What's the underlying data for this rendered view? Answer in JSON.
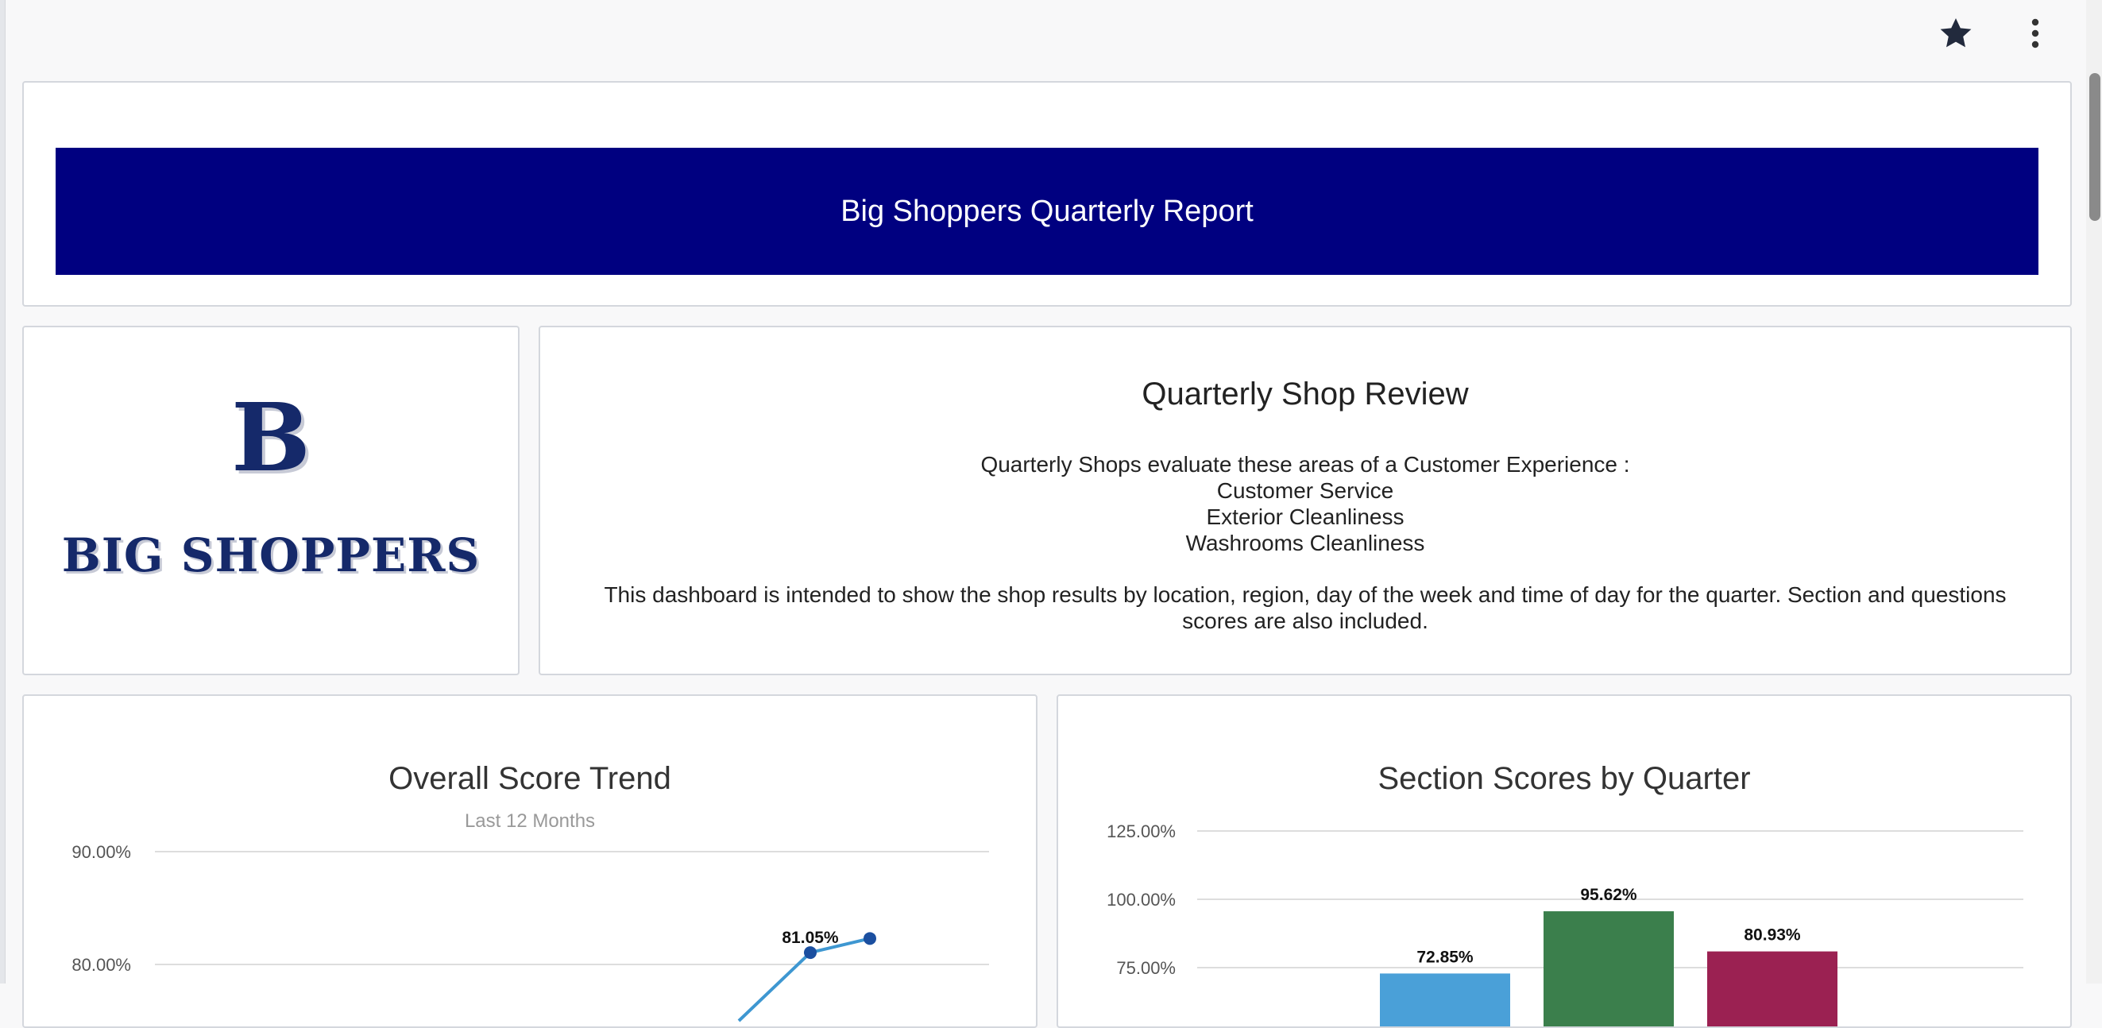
{
  "toolbar": {
    "favorite_icon": "star-icon",
    "more_icon": "more-vertical-icon"
  },
  "header": {
    "title": "Big Shoppers Quarterly Report",
    "banner_color": "#000080"
  },
  "logo": {
    "monogram": "B",
    "brand_text": "BIG SHOPPERS",
    "color": "#15296a"
  },
  "review": {
    "title": "Quarterly Shop Review",
    "intro": "Quarterly Shops evaluate these areas of a Customer Experience :",
    "areas": [
      "Customer Service",
      "Exterior Cleanliness",
      "Washrooms Cleanliness"
    ],
    "description": "This dashboard is intended to show the shop results by location, region, day of the week and time of day for the quarter. Section and questions scores are also included."
  },
  "chart_data": [
    {
      "type": "line",
      "title": "Overall Score Trend",
      "subtitle": "Last 12 Months",
      "y_ticks": [
        "90.00%",
        "80.00%"
      ],
      "ylim": [
        80,
        90
      ],
      "series": [
        {
          "color": "#3e97d1",
          "point_color": "#1b4fa0",
          "points": [
            {
              "y": 75.0
            },
            {
              "y": 81.05,
              "label": "81.05%"
            },
            {
              "y": 82.3
            }
          ]
        }
      ]
    },
    {
      "type": "bar",
      "title": "Section Scores by Quarter",
      "y_ticks": [
        "125.00%",
        "100.00%",
        "75.00%"
      ],
      "ylim": [
        75,
        125
      ],
      "values": [
        72.85,
        95.62,
        80.93
      ],
      "labels": [
        "72.85%",
        "95.62%",
        "80.93%"
      ],
      "colors": [
        "#4aa0d8",
        "#3b7f4c",
        "#9b2152"
      ]
    }
  ]
}
